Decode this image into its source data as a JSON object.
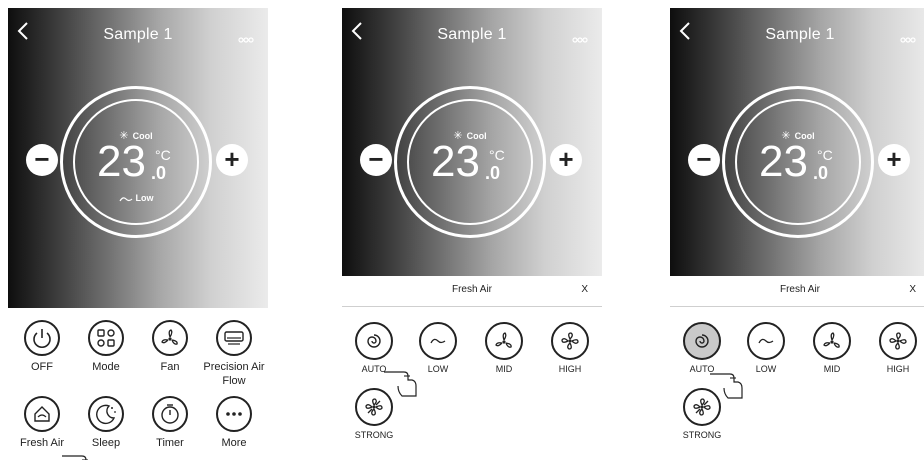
{
  "screens": [
    {
      "title": "Sample 1",
      "mode_label": "Cool",
      "temperature": "23",
      "decimal": ".0",
      "unit": "°C",
      "fan_label": "Low",
      "controls": {
        "minus": "−",
        "plus": "+"
      },
      "buttons": [
        {
          "label": "OFF",
          "icon": "power-icon"
        },
        {
          "label": "Mode",
          "icon": "mode-grid-icon"
        },
        {
          "label": "Fan",
          "icon": "fan-icon"
        },
        {
          "label": "Precision Air Flow",
          "icon": "air-flow-icon"
        },
        {
          "label": "Fresh Air",
          "icon": "fresh-air-icon"
        },
        {
          "label": "Sleep",
          "icon": "sleep-icon"
        },
        {
          "label": "Timer",
          "icon": "timer-icon"
        },
        {
          "label": "More",
          "icon": "more-icon"
        }
      ]
    },
    {
      "title": "Sample 1",
      "mode_label": "Cool",
      "temperature": "23",
      "decimal": ".0",
      "unit": "°C",
      "controls": {
        "minus": "−",
        "plus": "+"
      },
      "panel": {
        "title": "Fresh Air",
        "close": "X",
        "options": [
          {
            "label": "AUTO",
            "icon": "auto-swirl-icon",
            "selected": false
          },
          {
            "label": "LOW",
            "icon": "low-breeze-icon",
            "selected": false
          },
          {
            "label": "MID",
            "icon": "fan-icon",
            "selected": false
          },
          {
            "label": "HIGH",
            "icon": "fan-high-icon",
            "selected": false
          },
          {
            "label": "STRONG",
            "icon": "fan-strong-icon",
            "selected": false
          }
        ]
      }
    },
    {
      "title": "Sample 1",
      "mode_label": "Cool",
      "temperature": "23",
      "decimal": ".0",
      "unit": "°C",
      "controls": {
        "minus": "−",
        "plus": "+"
      },
      "panel": {
        "title": "Fresh Air",
        "close": "X",
        "options": [
          {
            "label": "AUTO",
            "icon": "auto-swirl-icon",
            "selected": true
          },
          {
            "label": "LOW",
            "icon": "low-breeze-icon",
            "selected": false
          },
          {
            "label": "MID",
            "icon": "fan-icon",
            "selected": false
          },
          {
            "label": "HIGH",
            "icon": "fan-high-icon",
            "selected": false
          },
          {
            "label": "STRONG",
            "icon": "fan-strong-icon",
            "selected": false
          }
        ]
      }
    }
  ],
  "colors": {
    "selected_option": "#c9c9c9",
    "gradient_dark": "#0e0e0e",
    "gradient_light": "#ebebeb"
  }
}
